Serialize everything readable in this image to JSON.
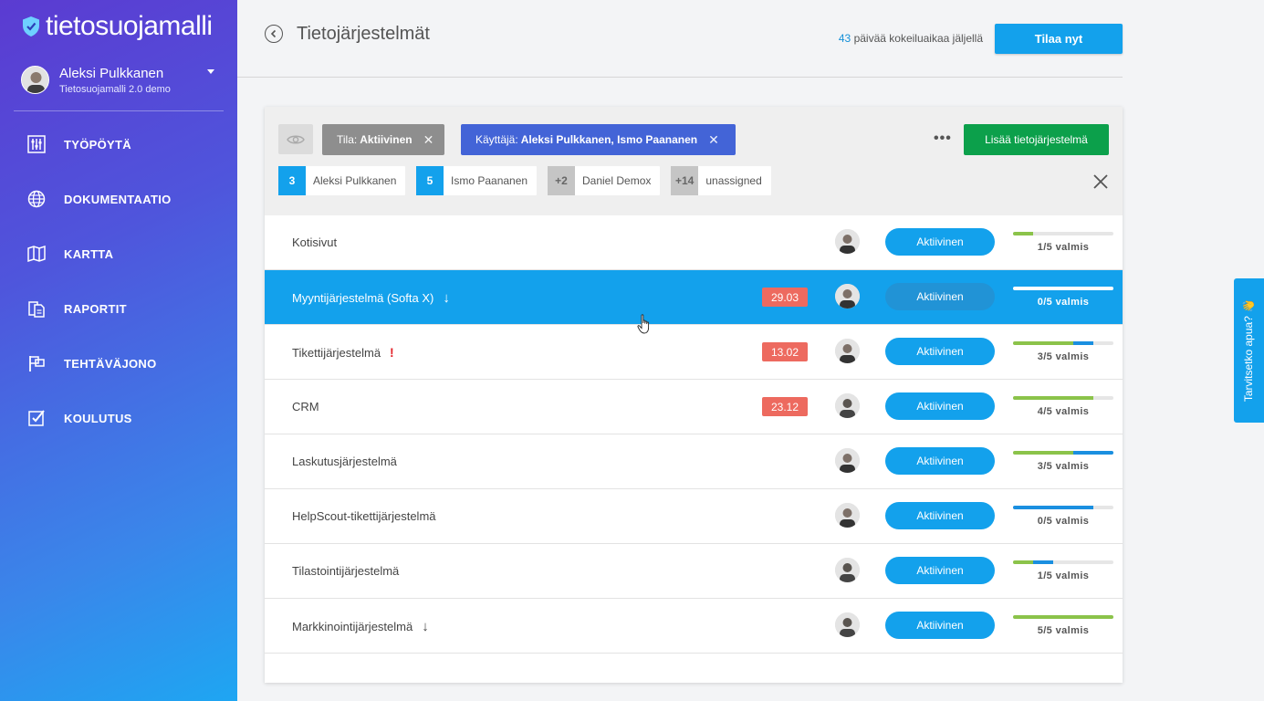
{
  "brand": {
    "name": "tietosuojamalli"
  },
  "user": {
    "name": "Aleksi Pulkkanen",
    "org": "Tietosuojamalli 2.0 demo"
  },
  "nav": [
    {
      "label": "TYÖPÖYTÄ",
      "icon": "sliders-icon"
    },
    {
      "label": "DOKUMENTAATIO",
      "icon": "globe-icon"
    },
    {
      "label": "KARTTA",
      "icon": "map-icon"
    },
    {
      "label": "RAPORTIT",
      "icon": "documents-icon"
    },
    {
      "label": "TEHTÄVÄJONO",
      "icon": "flag-icon"
    },
    {
      "label": "KOULUTUS",
      "icon": "checkbox-icon"
    }
  ],
  "header": {
    "title": "Tietojärjestelmät",
    "trial_days": "43",
    "trial_text": "päivää kokeiluaikaa jäljellä",
    "order_label": "Tilaa nyt"
  },
  "filters": {
    "status_prefix": "Tila:",
    "status_value": "Aktiivinen",
    "user_prefix": "Käyttäjä:",
    "user_value": "Aleksi Pulkkanen, Ismo Paananen",
    "more": "•••",
    "add_label": "Lisää tietojärjestelmä",
    "user_counts": [
      {
        "count": "3",
        "name": "Aleksi Pulkkanen"
      },
      {
        "count": "5",
        "name": "Ismo Paananen"
      },
      {
        "count": "+2",
        "name": "Daniel Demox"
      },
      {
        "count": "+14",
        "name": "unassigned"
      }
    ]
  },
  "rows": [
    {
      "name": "Kotisivut",
      "date": "",
      "status": "Aktiivinen",
      "progress_text": "1/5 valmis",
      "progress_green": 0.2,
      "progress_blue": 0
    },
    {
      "name": "Myyntijärjestelmä (Softa X)",
      "date": "29.03",
      "status": "Aktiivinen",
      "progress_text": "0/5 valmis",
      "progress_green": 0,
      "progress_blue": 0
    },
    {
      "name": "Tikettijärjestelmä",
      "date": "13.02",
      "status": "Aktiivinen",
      "progress_text": "3/5 valmis",
      "progress_green": 0.6,
      "progress_blue": 0.2
    },
    {
      "name": "CRM",
      "date": "23.12",
      "status": "Aktiivinen",
      "progress_text": "4/5 valmis",
      "progress_green": 0.8,
      "progress_blue": 0
    },
    {
      "name": "Laskutusjärjestelmä",
      "date": "",
      "status": "Aktiivinen",
      "progress_text": "3/5 valmis",
      "progress_green": 0.6,
      "progress_blue": 0.4
    },
    {
      "name": "HelpScout-tikettijärjestelmä",
      "date": "",
      "status": "Aktiivinen",
      "progress_text": "0/5 valmis",
      "progress_green": 0,
      "progress_blue": 0.8
    },
    {
      "name": "Tilastointijärjestelmä",
      "date": "",
      "status": "Aktiivinen",
      "progress_text": "1/5 valmis",
      "progress_green": 0.2,
      "progress_blue": 0.2
    },
    {
      "name": "Markkinointijärjestelmä",
      "date": "",
      "status": "Aktiivinen",
      "progress_text": "5/5 valmis",
      "progress_green": 1,
      "progress_blue": 0
    }
  ],
  "help": {
    "label": "Tarvitsetko apua? 👋"
  },
  "colors": {
    "accent": "#13a1ec",
    "add_green": "#0ca04b",
    "user_chip": "#4364d7",
    "date_badge": "#ed6a5f"
  }
}
